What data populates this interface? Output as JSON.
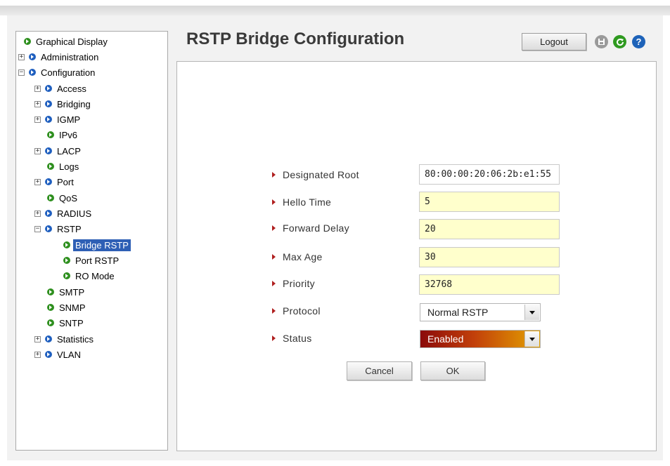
{
  "page": {
    "title": "RSTP Bridge Configuration",
    "logout_label": "Logout"
  },
  "header_icons": [
    "save-icon",
    "refresh-icon",
    "help-icon"
  ],
  "colors": {
    "tree_selection": "#2e5fb5",
    "input_background": "#ffffcc",
    "status_enabled_gradient": [
      "#8b0a0a",
      "#c2400a",
      "#e4a300"
    ],
    "blue_dot": "#1f5fbf",
    "green_dot": "#2e8f1e"
  },
  "tree": [
    {
      "label": "Graphical Display",
      "expander": "",
      "dot": "green"
    },
    {
      "label": "Administration",
      "expander": "+",
      "dot": "blue"
    },
    {
      "label": "Configuration",
      "expander": "−",
      "dot": "blue"
    },
    {
      "label": "Access",
      "expander": "+",
      "dot": "blue"
    },
    {
      "label": "Bridging",
      "expander": "+",
      "dot": "blue"
    },
    {
      "label": "IGMP",
      "expander": "+",
      "dot": "blue"
    },
    {
      "label": "IPv6",
      "expander": "",
      "dot": "green"
    },
    {
      "label": "LACP",
      "expander": "+",
      "dot": "blue"
    },
    {
      "label": "Logs",
      "expander": "",
      "dot": "green"
    },
    {
      "label": "Port",
      "expander": "+",
      "dot": "blue"
    },
    {
      "label": "QoS",
      "expander": "",
      "dot": "green"
    },
    {
      "label": "RADIUS",
      "expander": "+",
      "dot": "blue"
    },
    {
      "label": "RSTP",
      "expander": "−",
      "dot": "blue"
    },
    {
      "label": "Bridge RSTP",
      "expander": "",
      "dot": "green",
      "selected": true
    },
    {
      "label": "Port RSTP",
      "expander": "",
      "dot": "green"
    },
    {
      "label": "RO Mode",
      "expander": "",
      "dot": "green"
    },
    {
      "label": "SMTP",
      "expander": "",
      "dot": "green"
    },
    {
      "label": "SNMP",
      "expander": "",
      "dot": "green"
    },
    {
      "label": "SNTP",
      "expander": "",
      "dot": "green"
    },
    {
      "label": "Statistics",
      "expander": "+",
      "dot": "blue"
    },
    {
      "label": "VLAN",
      "expander": "+",
      "dot": "blue"
    }
  ],
  "form": {
    "designated_root": {
      "label": "Designated Root",
      "value": "80:00:00:20:06:2b:e1:55"
    },
    "hello_time": {
      "label": "Hello Time",
      "value": "5"
    },
    "forward_delay": {
      "label": "Forward Delay",
      "value": "20"
    },
    "max_age": {
      "label": "Max Age",
      "value": "30"
    },
    "priority": {
      "label": "Priority",
      "value": "32768"
    },
    "protocol": {
      "label": "Protocol",
      "value": "Normal RSTP"
    },
    "status": {
      "label": "Status",
      "value": "Enabled"
    }
  },
  "buttons": {
    "cancel": "Cancel",
    "ok": "OK"
  }
}
